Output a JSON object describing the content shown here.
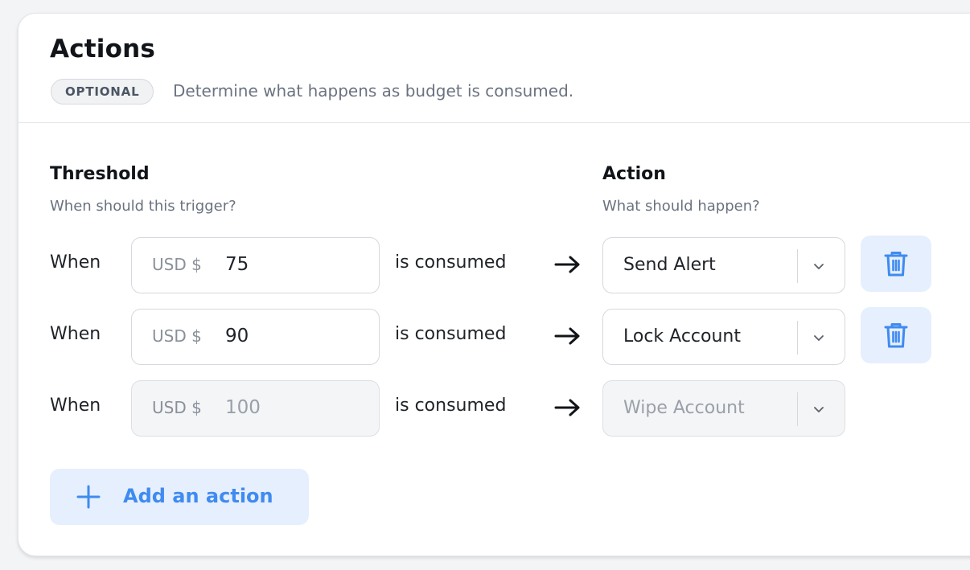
{
  "card": {
    "title": "Actions",
    "badge": "OPTIONAL",
    "subtitle": "Determine what happens as budget is consumed."
  },
  "columns": {
    "threshold": {
      "title": "Threshold",
      "subtitle": "When should this trigger?"
    },
    "action": {
      "title": "Action",
      "subtitle": "What should happen?"
    }
  },
  "rows": [
    {
      "when": "When",
      "currency": "USD $",
      "amount": "75",
      "consumed": "is consumed",
      "action": "Send Alert",
      "deletable": true,
      "disabled": false
    },
    {
      "when": "When",
      "currency": "USD $",
      "amount": "90",
      "consumed": "is consumed",
      "action": "Lock Account",
      "deletable": true,
      "disabled": false
    },
    {
      "when": "When",
      "currency": "USD $",
      "amount": "100",
      "consumed": "is consumed",
      "action": "Wipe Account",
      "deletable": false,
      "disabled": true
    }
  ],
  "add_button": {
    "label": "Add an action"
  },
  "icons": {
    "arrow": "arrow-right-icon",
    "chevron": "chevron-down-icon",
    "delete": "trash-icon",
    "add": "plus-icon"
  },
  "colors": {
    "accent": "#3f8bf0",
    "accent_bg": "#e6effd",
    "muted_text": "#6b7280",
    "border": "#d5d8dd"
  }
}
